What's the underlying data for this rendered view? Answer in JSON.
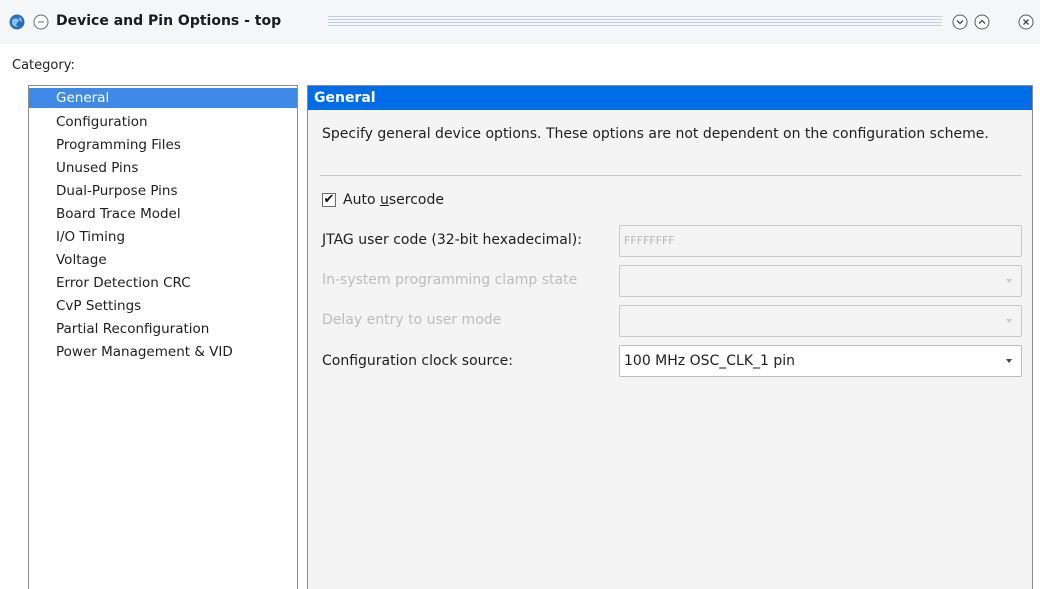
{
  "window": {
    "title": "Device and Pin Options - top",
    "icons": {
      "app": "app-globe-icon",
      "menu": "window-menu-icon",
      "minimize": "chevron-down-icon",
      "maximize": "chevron-up-icon",
      "close": "close-icon"
    }
  },
  "category_label": "Category:",
  "categories": [
    "General",
    "Configuration",
    "Programming Files",
    "Unused Pins",
    "Dual-Purpose Pins",
    "Board Trace Model",
    "I/O Timing",
    "Voltage",
    "Error Detection CRC",
    "CvP Settings",
    "Partial Reconfiguration",
    "Power Management & VID"
  ],
  "selected_category": "General",
  "panel": {
    "header": "General",
    "description": "Specify general device options. These options are not dependent on the configuration scheme.",
    "auto_usercode": {
      "label": "Auto usercode",
      "checked": true,
      "check_mark": "✔"
    },
    "jtag": {
      "label": "JTAG user code (32-bit hexadecimal):",
      "value": "FFFFFFFF"
    },
    "isp_clamp": {
      "label": "In-system programming clamp state",
      "value": ""
    },
    "delay_entry": {
      "label": "Delay entry to user mode",
      "value": ""
    },
    "clock_source": {
      "label": "Configuration clock source:",
      "value": "100 MHz OSC_CLK_1 pin"
    }
  },
  "colors": {
    "accent_header": "#006ce5",
    "selection": "#3f8ae7",
    "disabled_text": "#bdbdbd"
  }
}
